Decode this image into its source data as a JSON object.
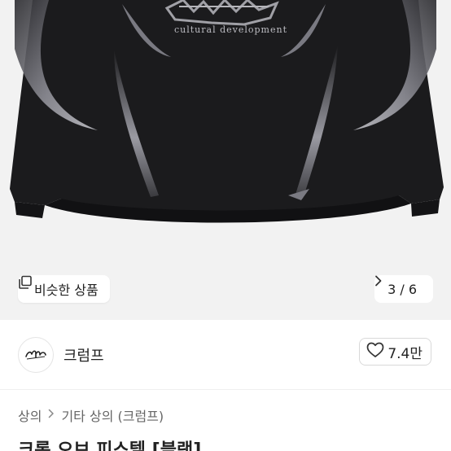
{
  "gallery": {
    "print_text": "cultural development",
    "similar_products_label": "비슷한 상품",
    "page_counter": "3 / 6"
  },
  "seller": {
    "name": "크럼프",
    "like_count": "7.4만"
  },
  "breadcrumb": {
    "items": [
      "상의",
      "기타 상의 (크럼프)"
    ]
  },
  "product": {
    "title": "크롭 오브 피스텔 [블랙]"
  },
  "icons": {
    "similar": "stacked-squares-icon",
    "next": "chevron-right-icon",
    "like": "heart-outline-icon",
    "separator": "chevron-right-icon"
  },
  "colors": {
    "garment": "#1b1b1d",
    "panel": "#9a9aa0",
    "background": "#f2f2f2"
  }
}
